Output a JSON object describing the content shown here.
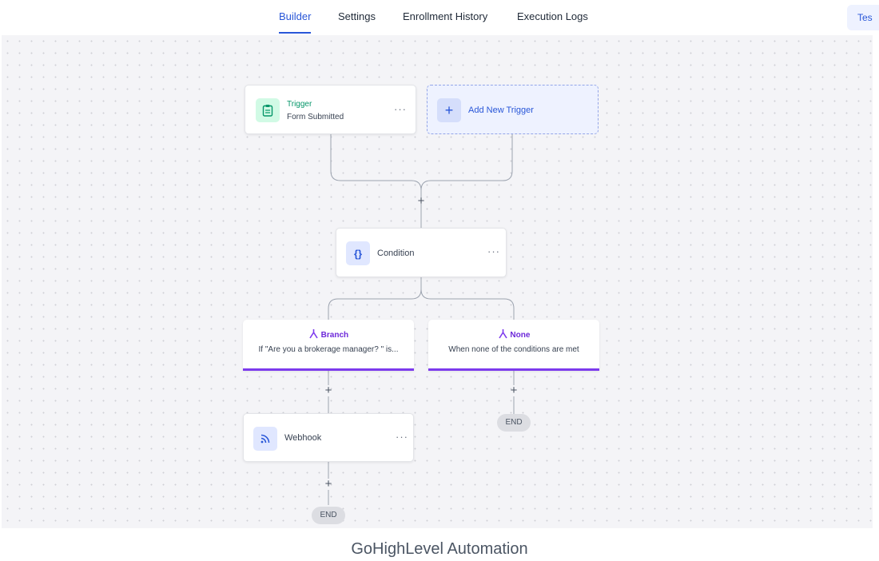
{
  "tabs": [
    {
      "label": "Builder",
      "active": true
    },
    {
      "label": "Settings",
      "active": false
    },
    {
      "label": "Enrollment History",
      "active": false
    },
    {
      "label": "Execution Logs",
      "active": false
    }
  ],
  "test_button": {
    "label": "Tes"
  },
  "trigger": {
    "title": "Trigger",
    "subtitle": "Form Submitted",
    "menu": "···"
  },
  "add_trigger": {
    "label": "Add New Trigger",
    "icon": "+"
  },
  "condition": {
    "label": "Condition",
    "icon": "{}",
    "menu": "···"
  },
  "branches": [
    {
      "title": "Branch",
      "description": "If \"Are you a brokerage manager? \" is..."
    },
    {
      "title": "None",
      "description": "When none of the conditions are met"
    }
  ],
  "webhook": {
    "label": "Webhook",
    "menu": "···"
  },
  "add_symbol": "+",
  "end_label": "END",
  "caption": "GoHighLevel Automation",
  "colors": {
    "accent": "#2856d8",
    "branch": "#7c3aed",
    "trigger_icon": "#10b981"
  }
}
